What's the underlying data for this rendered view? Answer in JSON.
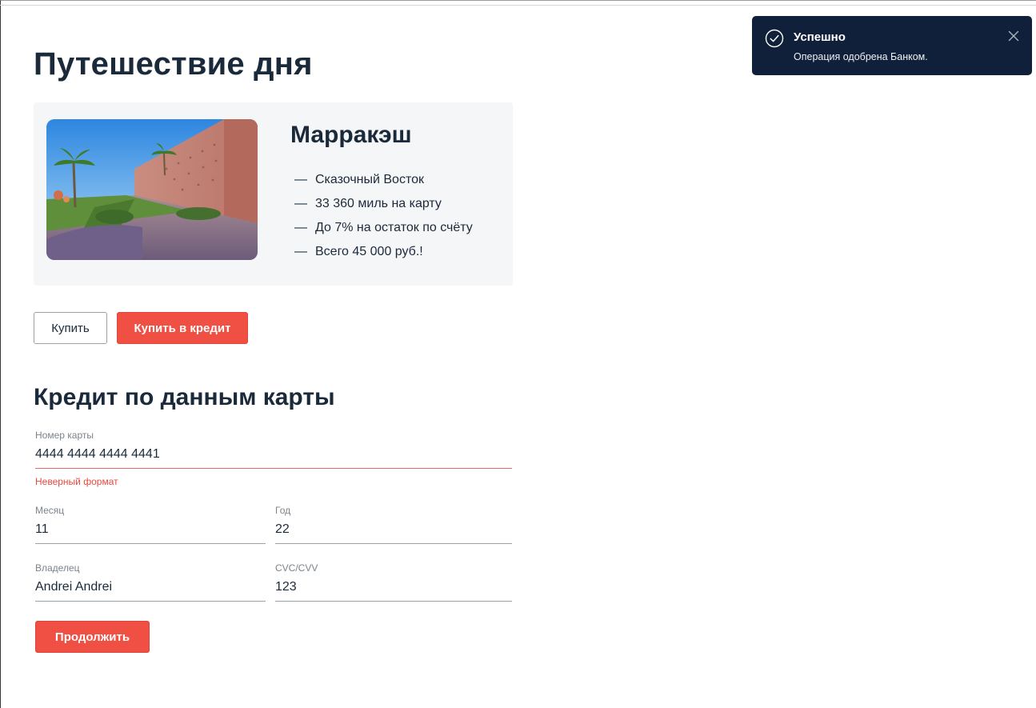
{
  "page": {
    "title": "Путешествие дня"
  },
  "offer": {
    "city": "Марракэш",
    "image_icon": "photo-marrakech",
    "features": [
      "Сказочный Восток",
      "33 360 миль на карту",
      "До 7% на остаток по счёту",
      "Всего 45 000 руб.!"
    ],
    "dash": "—"
  },
  "actions": {
    "buy_label": "Купить",
    "buy_credit_label": "Купить в кредит"
  },
  "form": {
    "title": "Кредит по данным карты",
    "card_number": {
      "label": "Номер карты",
      "value": "4444 4444 4444 4441",
      "error": "Неверный формат"
    },
    "month": {
      "label": "Месяц",
      "value": "11"
    },
    "year": {
      "label": "Год",
      "value": "22"
    },
    "owner": {
      "label": "Владелец",
      "value": "Andrei Andrei"
    },
    "cvc": {
      "label": "CVC/CVV",
      "value": "123"
    },
    "continue_label": "Продолжить"
  },
  "toast": {
    "title": "Успешно",
    "message": "Операция одобрена Банком.",
    "icon": "check-circle-icon",
    "close_icon": "close-icon"
  },
  "colors": {
    "accent": "#f04f43",
    "toast_bg": "#10203a",
    "text": "#1b2a3a",
    "error": "#e8493f",
    "card_bg": "#f5f6f8"
  }
}
